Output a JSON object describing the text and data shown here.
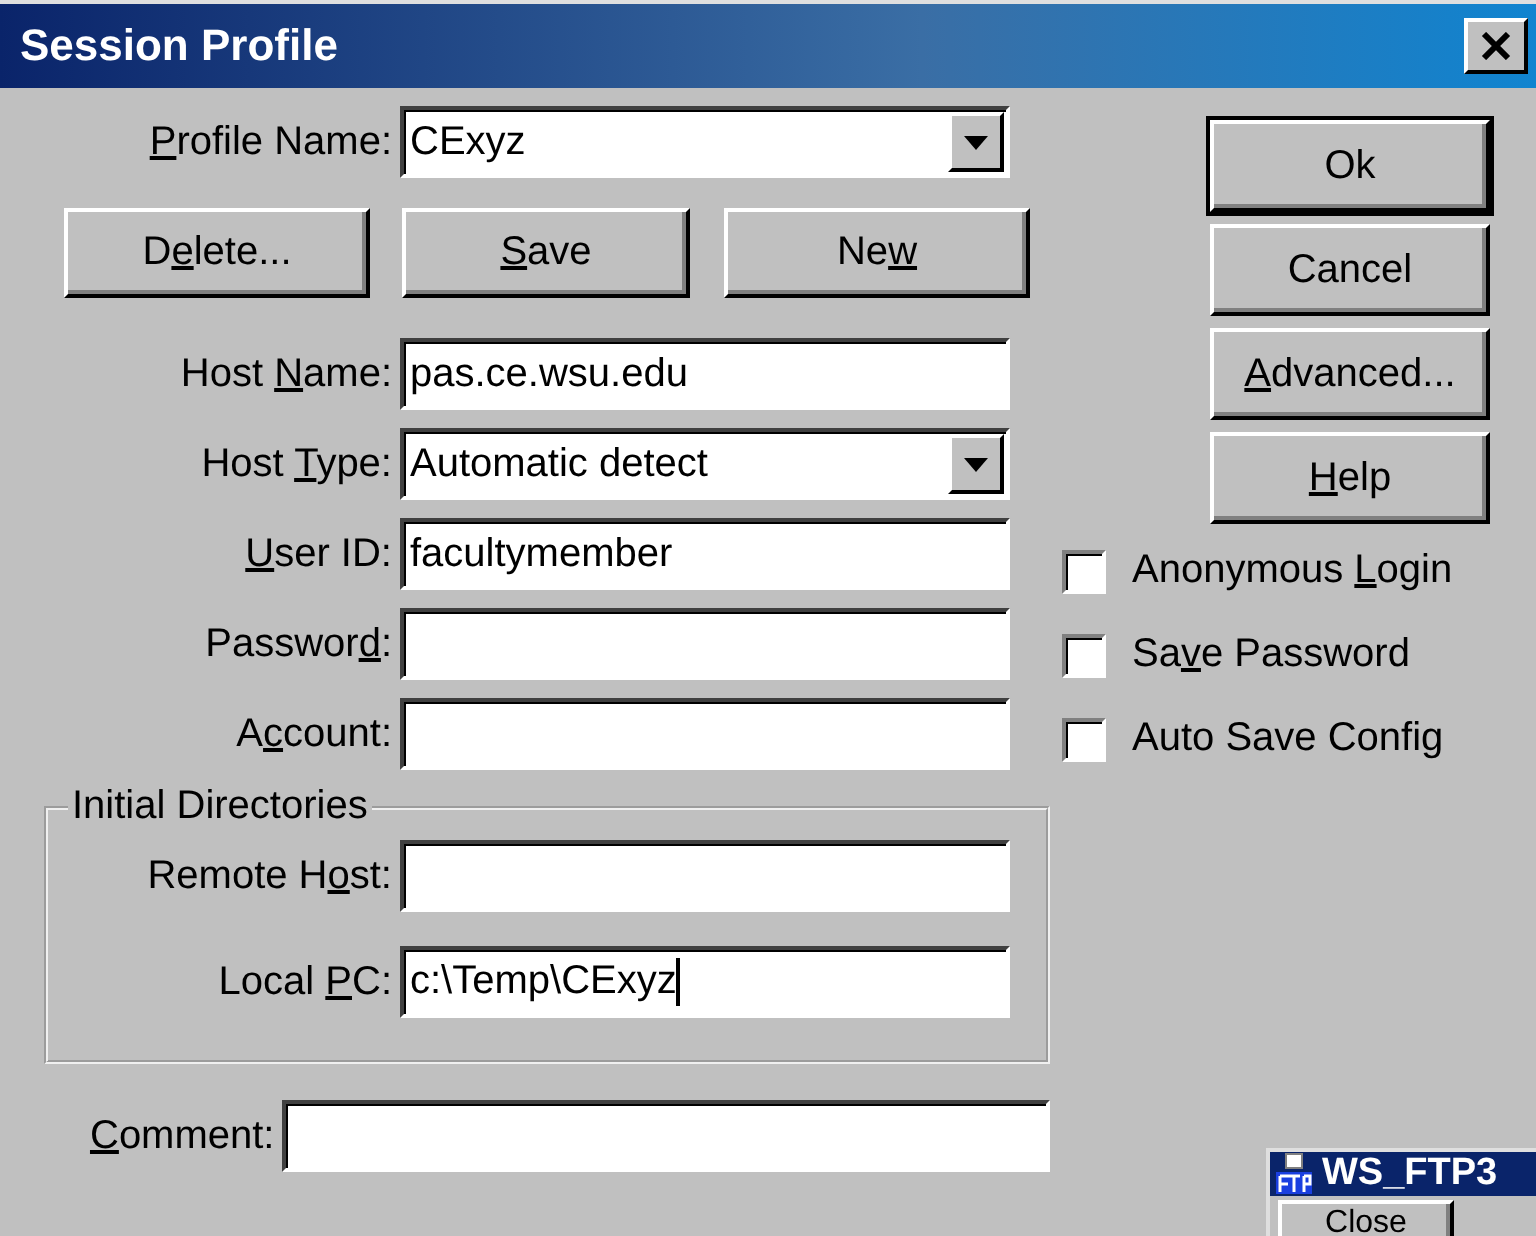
{
  "window": {
    "title": "Session Profile"
  },
  "profile": {
    "label": {
      "key": "P",
      "post": "rofile Name:"
    },
    "kind": "combo",
    "value": "CExyz"
  },
  "profile_buttons": [
    {
      "label": {
        "pre": "D",
        "key": "e",
        "post": "lete..."
      }
    },
    {
      "label": {
        "key": "S",
        "post": "ave"
      }
    },
    {
      "label": {
        "pre": "Ne",
        "key": "w"
      }
    }
  ],
  "fields": [
    {
      "label": {
        "pre": "Host ",
        "key": "N",
        "post": "ame:"
      },
      "kind": "text",
      "value": "pas.ce.wsu.edu"
    },
    {
      "label": {
        "pre": "Host ",
        "key": "T",
        "post": "ype:"
      },
      "kind": "combo",
      "value": "Automatic detect"
    },
    {
      "label": {
        "key": "U",
        "post": "ser ID:"
      },
      "kind": "text",
      "value": "facultymember"
    },
    {
      "label": {
        "pre": "Passwor",
        "key": "d",
        "post": ":"
      },
      "kind": "text"
    },
    {
      "label": {
        "pre": "A",
        "key": "c",
        "post": "count:"
      },
      "kind": "text"
    }
  ],
  "initial_directories": {
    "title": "Initial Directories",
    "fields": [
      {
        "label": {
          "pre": "Remote H",
          "key": "o",
          "post": "st:"
        },
        "kind": "text"
      },
      {
        "label": {
          "pre": "Local ",
          "key": "P",
          "post": "C:"
        },
        "kind": "text",
        "value": "c:\\Temp\\CExyz",
        "focused": true
      }
    ]
  },
  "comment": {
    "label": {
      "key": "C",
      "post": "omment:"
    },
    "kind": "text"
  },
  "buttons": [
    {
      "label": "Ok",
      "default": true
    },
    {
      "label": "Cancel",
      "default": false
    },
    {
      "label": {
        "key": "A",
        "post": "dvanced..."
      },
      "default": false
    },
    {
      "label": {
        "key": "H",
        "post": "elp"
      },
      "default": false
    }
  ],
  "options": [
    {
      "label": {
        "pre": "Anonymous ",
        "key": "L",
        "post": "ogin"
      },
      "checked": false
    },
    {
      "label": {
        "pre": "Sa",
        "key": "v",
        "post": "e Password"
      },
      "checked": false
    },
    {
      "label": "Auto Save Config",
      "checked": false
    }
  ],
  "overlapping_window": {
    "title": "WS_FTP3",
    "buttons": [
      "Close"
    ]
  }
}
